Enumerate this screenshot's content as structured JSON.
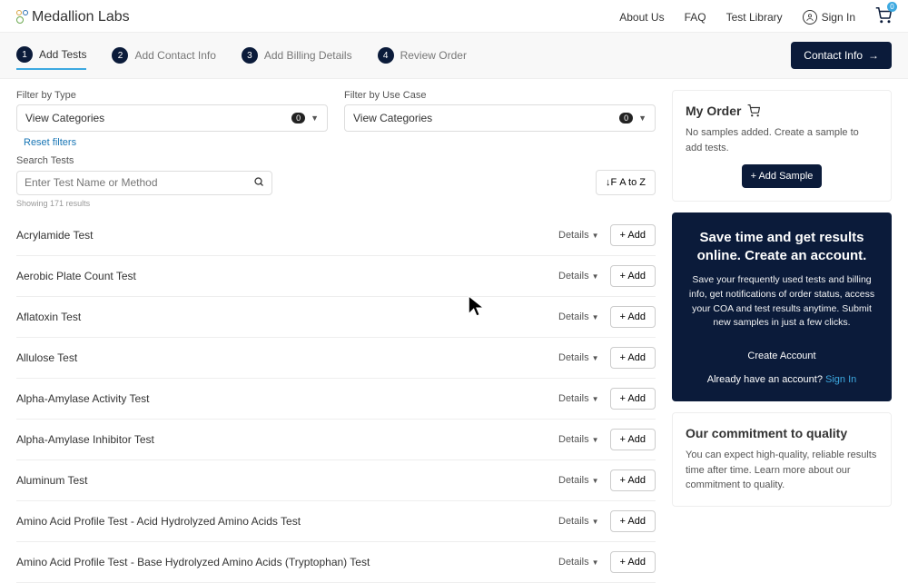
{
  "brand": "Medallion Labs",
  "nav": {
    "about": "About Us",
    "faq": "FAQ",
    "library": "Test Library",
    "signin": "Sign In",
    "cart_count": "0"
  },
  "steps": {
    "s1": "Add Tests",
    "s2": "Add Contact Info",
    "s3": "Add Billing Details",
    "s4": "Review Order"
  },
  "cta_contact": "Contact Info",
  "filters": {
    "type_label": "Filter by Type",
    "use_label": "Filter by Use Case",
    "view_categories": "View Categories",
    "type_count": "0",
    "use_count": "0",
    "reset": "Reset filters"
  },
  "search": {
    "label": "Search Tests",
    "placeholder": "Enter Test Name or Method"
  },
  "sort": "A to Z",
  "results": {
    "showing": "Showing",
    "count": "171",
    "word": "results"
  },
  "details_label": "Details",
  "add_label": "+ Add",
  "tests": [
    "Acrylamide Test",
    "Aerobic Plate Count Test",
    "Aflatoxin Test",
    "Allulose Test",
    "Alpha-Amylase Activity Test",
    "Alpha-Amylase Inhibitor Test",
    "Aluminum Test",
    "Amino Acid Profile Test - Acid Hydrolyzed Amino Acids Test",
    "Amino Acid Profile Test - Base Hydrolyzed Amino Acids (Tryptophan) Test"
  ],
  "order": {
    "title": "My Order",
    "empty": "No samples added. Create a sample to add tests.",
    "add_sample": "+ Add Sample"
  },
  "promo": {
    "title": "Save time and get results online. Create an account.",
    "body": "Save your frequently used tests and billing info, get notifications of order status, access your COA and test results anytime. Submit new samples in just a few clicks.",
    "create": "Create Account",
    "already": "Already have an account?",
    "signin": "Sign In"
  },
  "quality": {
    "title": "Our commitment to quality",
    "body": "You can expect high-quality, reliable results time after time. Learn more about our commitment to quality."
  }
}
